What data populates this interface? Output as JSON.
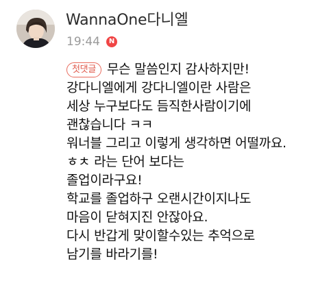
{
  "author": {
    "name": "WannaOne다니엘",
    "avatar_icon": "profile-photo-icon"
  },
  "meta": {
    "time": "19:44",
    "new_badge": "N",
    "badge_color": "#f04545"
  },
  "comment": {
    "tag": "첫댓글",
    "tag_color": "#e05a4c",
    "lines": [
      "무슨 말씀인지 감사하지만!",
      "강다니엘에게 강다니엘이란 사람은",
      "세상 누구보다도 듬직한사람이기에",
      "괜찮습니다 ㅋㅋ",
      "워너블 그리고 이렇게 생각하면 어떨까요.",
      "ㅎㅊ 라는 단어 보다는",
      "졸업이라구요!",
      "학교를 졸업하구 오랜시간이지나도",
      "마음이 닫혀지진 안잖아요.",
      "다시 반갑게 맞이할수있는 추억으로",
      "남기를 바라기를!"
    ]
  }
}
